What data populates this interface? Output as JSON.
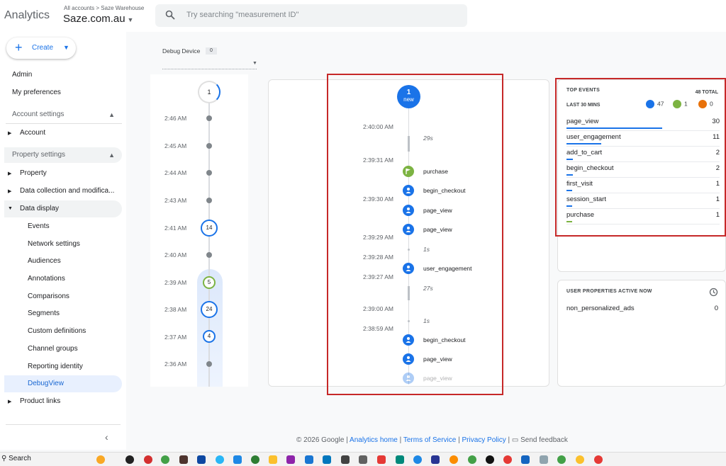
{
  "header": {
    "brand": "Analytics",
    "breadcrumb_all": "All accounts",
    "breadcrumb_sep": ">",
    "breadcrumb_account": "Saze Warehouse",
    "property": "Saze.com.au",
    "search_placeholder": "Try searching \"measurement ID\""
  },
  "sidebar": {
    "create": "Create",
    "admin": "Admin",
    "preferences": "My preferences",
    "account_settings": "Account settings",
    "account": "Account",
    "property_settings": "Property settings",
    "property": "Property",
    "data_collection": "Data collection and modifica...",
    "data_display": "Data display",
    "sub_items": [
      "Events",
      "Network settings",
      "Audiences",
      "Annotations",
      "Comparisons",
      "Segments",
      "Custom definitions",
      "Channel groups",
      "Reporting identity",
      "DebugView"
    ],
    "product_links": "Product links"
  },
  "debug": {
    "device_label": "Debug Device",
    "device_count": "0"
  },
  "minutes": {
    "top_count": "1",
    "rows": [
      {
        "time": "2:46 AM",
        "count": ""
      },
      {
        "time": "2:45 AM",
        "count": ""
      },
      {
        "time": "2:44 AM",
        "count": ""
      },
      {
        "time": "2:43 AM",
        "count": ""
      },
      {
        "time": "2:41 AM",
        "count": "14"
      },
      {
        "time": "2:40 AM",
        "count": ""
      },
      {
        "time": "2:39 AM",
        "count": "5"
      },
      {
        "time": "2:38 AM",
        "count": "24"
      },
      {
        "time": "2:37 AM",
        "count": "4"
      },
      {
        "time": "2:36 AM",
        "count": ""
      }
    ]
  },
  "timeline": {
    "new_count": "1",
    "new_label": "new",
    "times": [
      "2:40:00 AM",
      "2:39:31 AM",
      "2:39:30 AM",
      "2:39:29 AM",
      "2:39:28 AM",
      "2:39:27 AM",
      "2:39:00 AM",
      "2:38:59 AM"
    ],
    "durations": [
      "29s",
      "1s",
      "27s",
      "1s"
    ],
    "events": [
      "purchase",
      "begin_checkout",
      "page_view",
      "page_view",
      "user_engagement",
      "begin_checkout",
      "page_view",
      "page_view"
    ]
  },
  "top_events": {
    "title": "TOP EVENTS",
    "total": "48 TOTAL",
    "period": "LAST 30 MINS",
    "stat_blue": "47",
    "stat_green": "1",
    "stat_orange": "0",
    "rows": [
      {
        "name": "page_view",
        "count": "30",
        "share": 0.625
      },
      {
        "name": "user_engagement",
        "count": "11",
        "share": 0.229
      },
      {
        "name": "add_to_cart",
        "count": "2",
        "share": 0.042
      },
      {
        "name": "begin_checkout",
        "count": "2",
        "share": 0.042
      },
      {
        "name": "first_visit",
        "count": "1",
        "share": 0.021
      },
      {
        "name": "session_start",
        "count": "1",
        "share": 0.021
      },
      {
        "name": "purchase",
        "count": "1",
        "share": 0.021
      }
    ]
  },
  "user_props": {
    "title": "USER PROPERTIES ACTIVE NOW",
    "name": "non_personalized_ads",
    "value": "0"
  },
  "footer": {
    "copyright": "© 2026 Google |",
    "analytics_home": "Analytics home",
    "terms": "Terms of Service",
    "privacy": "Privacy Policy",
    "sep": "|",
    "feedback": "Send feedback"
  },
  "taskbar": {
    "search": "Search"
  }
}
